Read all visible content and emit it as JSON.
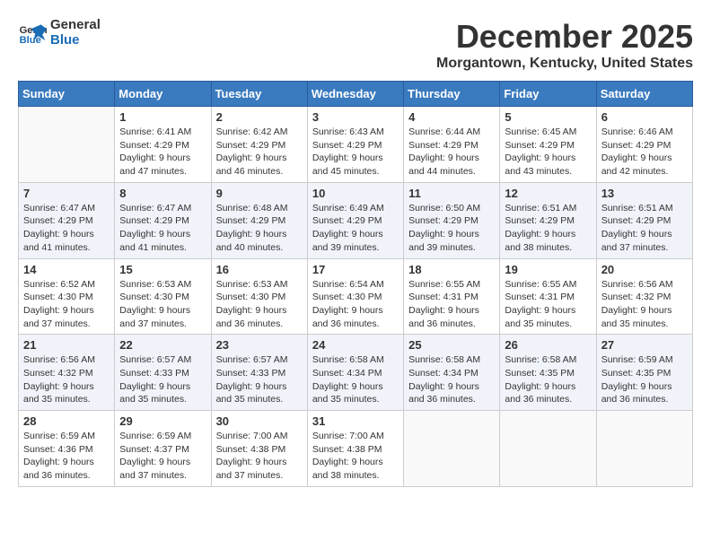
{
  "logo": {
    "line1": "General",
    "line2": "Blue"
  },
  "title": "December 2025",
  "location": "Morgantown, Kentucky, United States",
  "weekdays": [
    "Sunday",
    "Monday",
    "Tuesday",
    "Wednesday",
    "Thursday",
    "Friday",
    "Saturday"
  ],
  "weeks": [
    [
      {
        "num": "",
        "empty": true
      },
      {
        "num": "1",
        "sunrise": "6:41 AM",
        "sunset": "4:29 PM",
        "daylight": "9 hours and 47 minutes."
      },
      {
        "num": "2",
        "sunrise": "6:42 AM",
        "sunset": "4:29 PM",
        "daylight": "9 hours and 46 minutes."
      },
      {
        "num": "3",
        "sunrise": "6:43 AM",
        "sunset": "4:29 PM",
        "daylight": "9 hours and 45 minutes."
      },
      {
        "num": "4",
        "sunrise": "6:44 AM",
        "sunset": "4:29 PM",
        "daylight": "9 hours and 44 minutes."
      },
      {
        "num": "5",
        "sunrise": "6:45 AM",
        "sunset": "4:29 PM",
        "daylight": "9 hours and 43 minutes."
      },
      {
        "num": "6",
        "sunrise": "6:46 AM",
        "sunset": "4:29 PM",
        "daylight": "9 hours and 42 minutes."
      }
    ],
    [
      {
        "num": "7",
        "sunrise": "6:47 AM",
        "sunset": "4:29 PM",
        "daylight": "9 hours and 41 minutes."
      },
      {
        "num": "8",
        "sunrise": "6:47 AM",
        "sunset": "4:29 PM",
        "daylight": "9 hours and 41 minutes."
      },
      {
        "num": "9",
        "sunrise": "6:48 AM",
        "sunset": "4:29 PM",
        "daylight": "9 hours and 40 minutes."
      },
      {
        "num": "10",
        "sunrise": "6:49 AM",
        "sunset": "4:29 PM",
        "daylight": "9 hours and 39 minutes."
      },
      {
        "num": "11",
        "sunrise": "6:50 AM",
        "sunset": "4:29 PM",
        "daylight": "9 hours and 39 minutes."
      },
      {
        "num": "12",
        "sunrise": "6:51 AM",
        "sunset": "4:29 PM",
        "daylight": "9 hours and 38 minutes."
      },
      {
        "num": "13",
        "sunrise": "6:51 AM",
        "sunset": "4:29 PM",
        "daylight": "9 hours and 37 minutes."
      }
    ],
    [
      {
        "num": "14",
        "sunrise": "6:52 AM",
        "sunset": "4:30 PM",
        "daylight": "9 hours and 37 minutes."
      },
      {
        "num": "15",
        "sunrise": "6:53 AM",
        "sunset": "4:30 PM",
        "daylight": "9 hours and 37 minutes."
      },
      {
        "num": "16",
        "sunrise": "6:53 AM",
        "sunset": "4:30 PM",
        "daylight": "9 hours and 36 minutes."
      },
      {
        "num": "17",
        "sunrise": "6:54 AM",
        "sunset": "4:30 PM",
        "daylight": "9 hours and 36 minutes."
      },
      {
        "num": "18",
        "sunrise": "6:55 AM",
        "sunset": "4:31 PM",
        "daylight": "9 hours and 36 minutes."
      },
      {
        "num": "19",
        "sunrise": "6:55 AM",
        "sunset": "4:31 PM",
        "daylight": "9 hours and 35 minutes."
      },
      {
        "num": "20",
        "sunrise": "6:56 AM",
        "sunset": "4:32 PM",
        "daylight": "9 hours and 35 minutes."
      }
    ],
    [
      {
        "num": "21",
        "sunrise": "6:56 AM",
        "sunset": "4:32 PM",
        "daylight": "9 hours and 35 minutes."
      },
      {
        "num": "22",
        "sunrise": "6:57 AM",
        "sunset": "4:33 PM",
        "daylight": "9 hours and 35 minutes."
      },
      {
        "num": "23",
        "sunrise": "6:57 AM",
        "sunset": "4:33 PM",
        "daylight": "9 hours and 35 minutes."
      },
      {
        "num": "24",
        "sunrise": "6:58 AM",
        "sunset": "4:34 PM",
        "daylight": "9 hours and 35 minutes."
      },
      {
        "num": "25",
        "sunrise": "6:58 AM",
        "sunset": "4:34 PM",
        "daylight": "9 hours and 36 minutes."
      },
      {
        "num": "26",
        "sunrise": "6:58 AM",
        "sunset": "4:35 PM",
        "daylight": "9 hours and 36 minutes."
      },
      {
        "num": "27",
        "sunrise": "6:59 AM",
        "sunset": "4:35 PM",
        "daylight": "9 hours and 36 minutes."
      }
    ],
    [
      {
        "num": "28",
        "sunrise": "6:59 AM",
        "sunset": "4:36 PM",
        "daylight": "9 hours and 36 minutes."
      },
      {
        "num": "29",
        "sunrise": "6:59 AM",
        "sunset": "4:37 PM",
        "daylight": "9 hours and 37 minutes."
      },
      {
        "num": "30",
        "sunrise": "7:00 AM",
        "sunset": "4:38 PM",
        "daylight": "9 hours and 37 minutes."
      },
      {
        "num": "31",
        "sunrise": "7:00 AM",
        "sunset": "4:38 PM",
        "daylight": "9 hours and 38 minutes."
      },
      {
        "num": "",
        "empty": true
      },
      {
        "num": "",
        "empty": true
      },
      {
        "num": "",
        "empty": true
      }
    ]
  ],
  "labels": {
    "sunrise": "Sunrise:",
    "sunset": "Sunset:",
    "daylight": "Daylight:"
  }
}
